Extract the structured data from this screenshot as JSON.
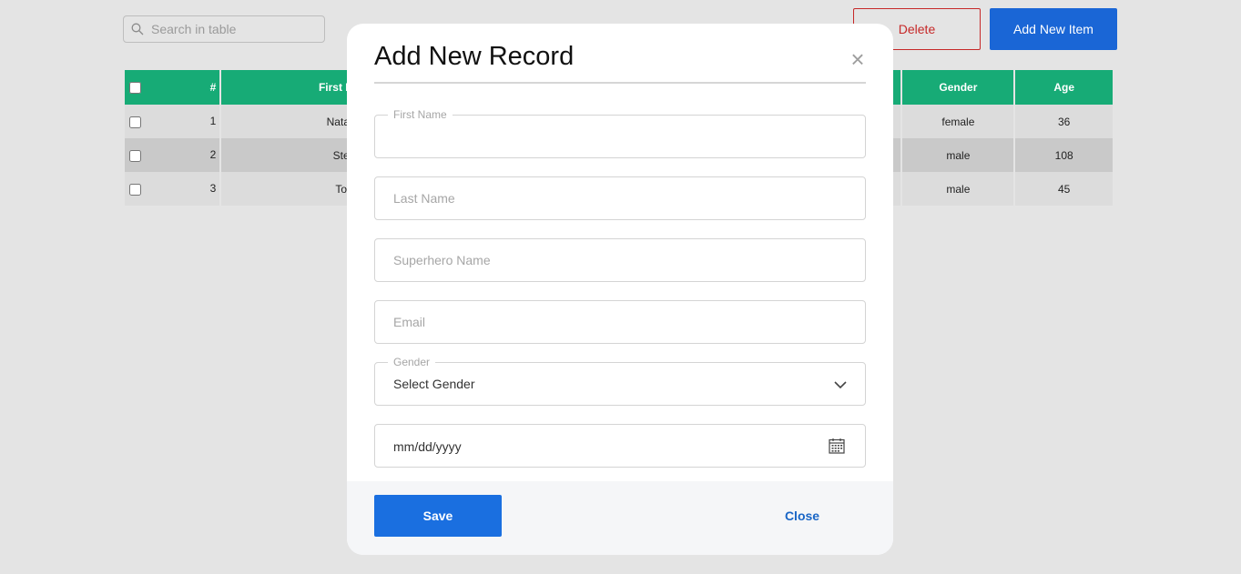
{
  "toolbar": {
    "search_placeholder": "Search in table",
    "delete_label": "Delete",
    "add_label": "Add New Item"
  },
  "table": {
    "headers": [
      "",
      "#",
      "First Name",
      "Gender",
      "Age"
    ],
    "rows": [
      {
        "index": "1",
        "first_name": "Natasha",
        "gender": "female",
        "age": "36"
      },
      {
        "index": "2",
        "first_name": "Steve",
        "gender": "male",
        "age": "108"
      },
      {
        "index": "3",
        "first_name": "Tony",
        "gender": "male",
        "age": "45"
      }
    ]
  },
  "modal": {
    "title": "Add New Record",
    "close_glyph": "×",
    "fields": {
      "first_name": {
        "label": "First Name",
        "value": ""
      },
      "last_name": {
        "placeholder": "Last Name"
      },
      "superhero_name": {
        "placeholder": "Superhero Name"
      },
      "email": {
        "placeholder": "Email"
      },
      "gender": {
        "label": "Gender",
        "selected": "Select Gender"
      },
      "date": {
        "value": "mm/dd/yyyy"
      }
    },
    "save_label": "Save",
    "close_label": "Close"
  },
  "colors": {
    "header_green": "#17ab76",
    "primary_blue": "#1a66d6",
    "delete_red": "#c62828"
  },
  "icons": [
    "search-icon",
    "close-icon",
    "chevron-down-icon",
    "calendar-icon"
  ]
}
